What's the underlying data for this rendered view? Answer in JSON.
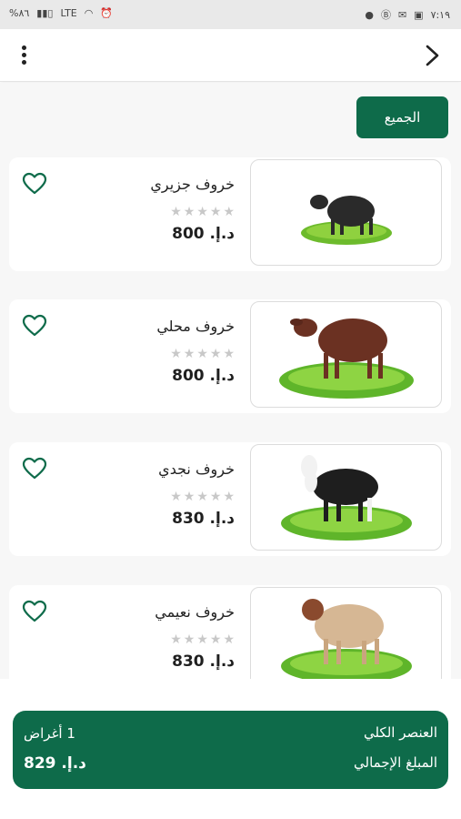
{
  "status_bar": {
    "time": "٧:١٩",
    "battery": "%٨٦",
    "network": "LTE"
  },
  "filter": {
    "label": "الجميع"
  },
  "products": [
    {
      "name": "خروف جزيري",
      "price": "د.إ. 800",
      "rating": 0,
      "color": "#2a2a2a"
    },
    {
      "name": "خروف محلي",
      "price": "د.إ. 800",
      "rating": 0,
      "color": "#6b3122"
    },
    {
      "name": "خروف نجدي",
      "price": "د.إ. 830",
      "rating": 0,
      "color": "#1e1e1e"
    },
    {
      "name": "خروف نعيمي",
      "price": "د.إ. 830",
      "rating": 0,
      "color": "#d6b794"
    }
  ],
  "summary": {
    "total_items_label": "العنصر الكلي",
    "total_items_value": "1 أغراض",
    "total_amount_label": "المبلغ الإجمالي",
    "total_amount_value": "د.إ. 829"
  },
  "colors": {
    "accent": "#0e6b4a",
    "background": "#f7f7f7"
  }
}
